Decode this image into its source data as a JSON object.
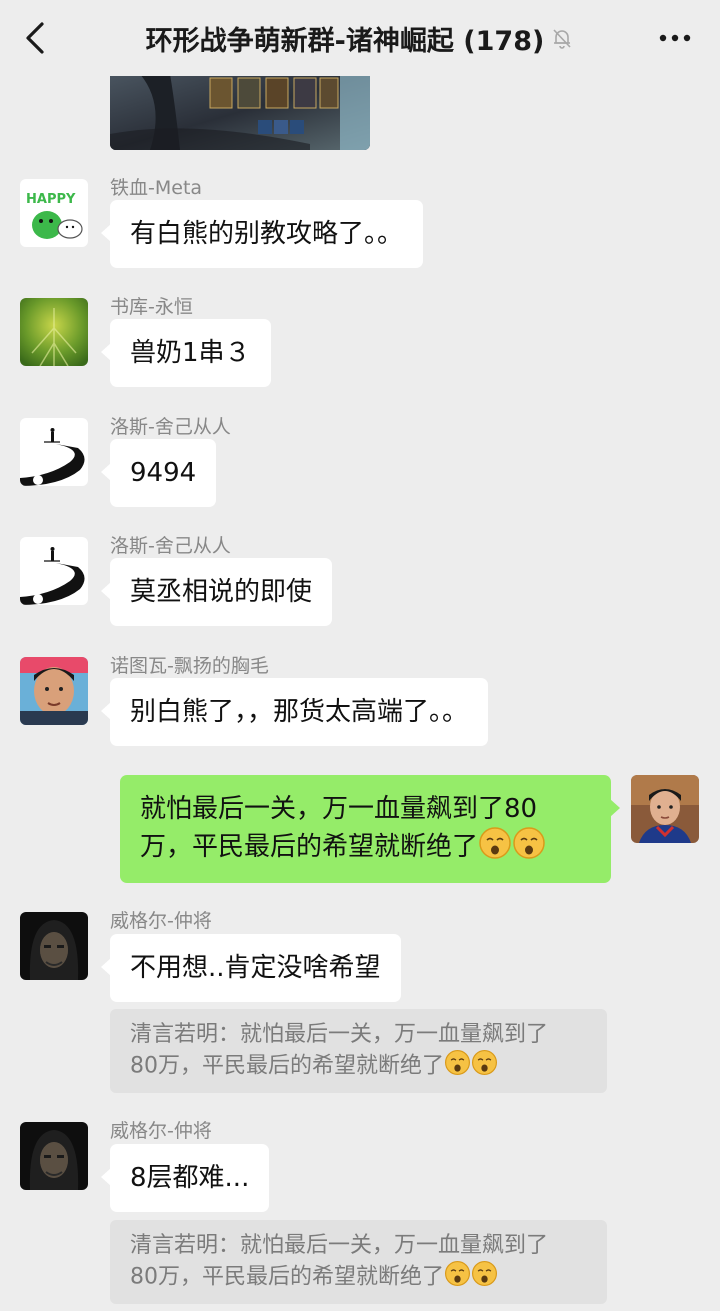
{
  "header": {
    "title": "环形战争萌新群-诸神崛起 (178)",
    "back_icon": "chevron-left-icon",
    "mute_icon": "bell-slash-icon",
    "more_icon": "ellipsis-icon"
  },
  "messages": [
    {
      "sender": "铁血-Meta",
      "text": "有白熊的别教攻略了。。"
    },
    {
      "sender": "书库-永恒",
      "text": "兽奶1串３"
    },
    {
      "sender": "洛斯-舍己从人",
      "text": "9494"
    },
    {
      "sender": "洛斯-舍己从人",
      "text": "莫丞相说的即使"
    },
    {
      "sender": "诺图瓦-飘扬的胸毛",
      "text": "别白熊了，，那货太高端了。。"
    },
    {
      "sender": "",
      "line1": "就怕最后一关，万一血量飙到了80",
      "line2": "万，平民最后的希望就断绝了"
    },
    {
      "sender": "威格尔-仲将",
      "text": "不用想..肯定没啥希望",
      "quote_line1": "清言若明：就怕最后一关，万一血量飙到了",
      "quote_line2": "80万，平民最后的希望就断绝了"
    },
    {
      "sender": "威格尔-仲将",
      "text": "8层都难...",
      "quote_line1": "清言若明：就怕最后一关，万一血量飙到了",
      "quote_line2": "80万，平民最后的希望就断绝了"
    }
  ],
  "colors": {
    "background": "#ededed",
    "bubble_self": "#95ec69",
    "bubble_other": "#ffffff",
    "quote_bg": "#e1e1e1"
  }
}
